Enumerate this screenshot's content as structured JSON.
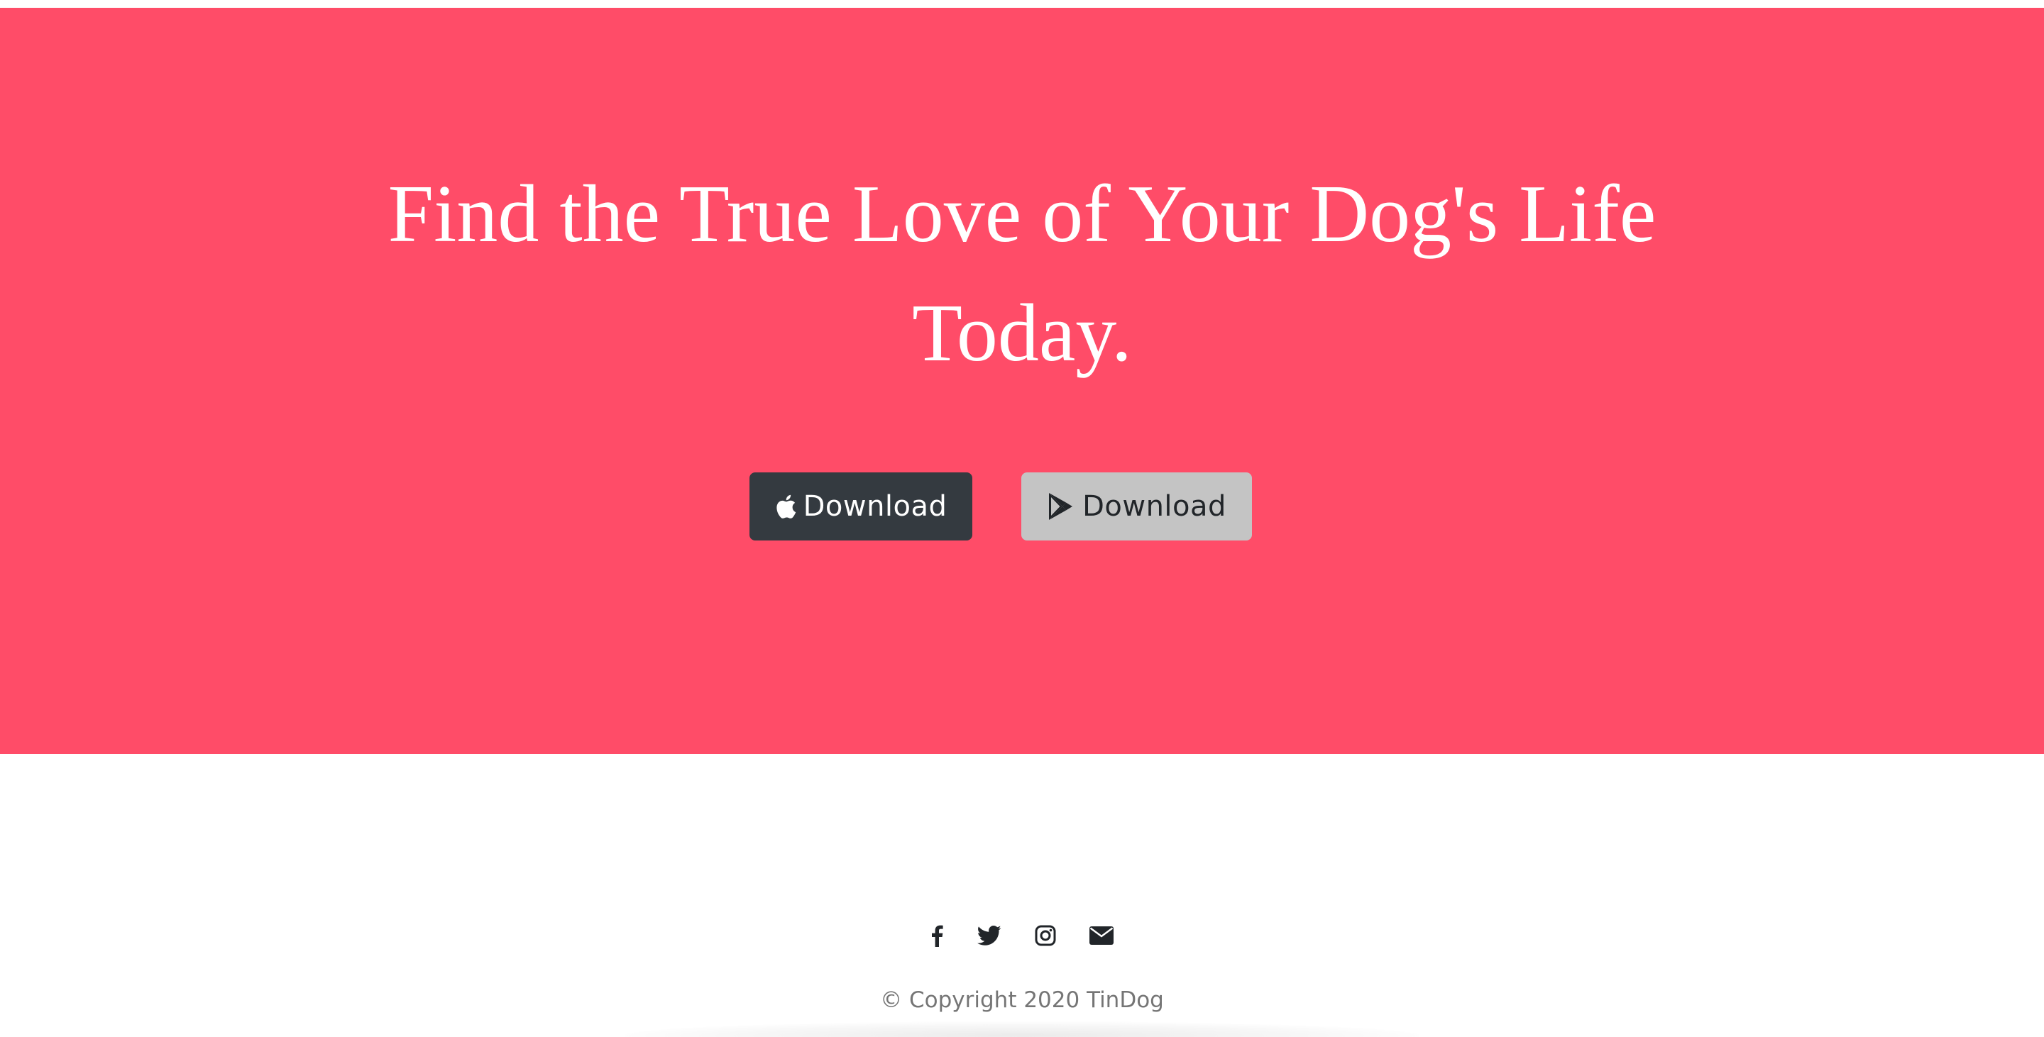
{
  "hero": {
    "headline": "Find the True Love of Your Dog's Life Today.",
    "background_color": "#ff4c68",
    "buttons": [
      {
        "label": "Download",
        "icon": "apple-icon",
        "color": "#343a40"
      },
      {
        "label": "Download",
        "icon": "google-play-icon",
        "color": "#c4c4c4"
      }
    ]
  },
  "footer": {
    "social_icons": [
      "facebook-icon",
      "twitter-icon",
      "instagram-icon",
      "envelope-icon"
    ],
    "copyright": "© Copyright 2020 TinDog"
  }
}
